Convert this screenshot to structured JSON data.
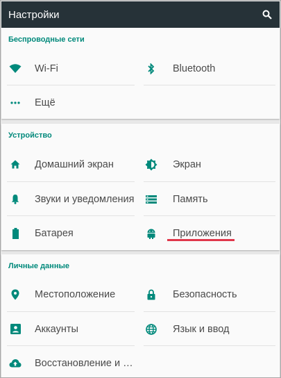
{
  "appbar": {
    "title": "Настройки",
    "search_icon": "search-icon"
  },
  "colors": {
    "appbar": "#263238",
    "accent": "#00897b",
    "highlight": "#e0374b"
  },
  "sections": {
    "wireless": {
      "title": "Беспроводные сети",
      "wifi": "Wi-Fi",
      "bluetooth": "Bluetooth",
      "more": "Ещё"
    },
    "device": {
      "title": "Устройство",
      "home": "Домашний экран",
      "display": "Экран",
      "sound": "Звуки и уведомления",
      "storage": "Память",
      "battery": "Батарея",
      "apps": "Приложения"
    },
    "personal": {
      "title": "Личные данные",
      "location": "Местоположение",
      "security": "Безопасность",
      "accounts": "Аккаунты",
      "language": "Язык и ввод",
      "backup": "Восстановление и сброс"
    }
  }
}
